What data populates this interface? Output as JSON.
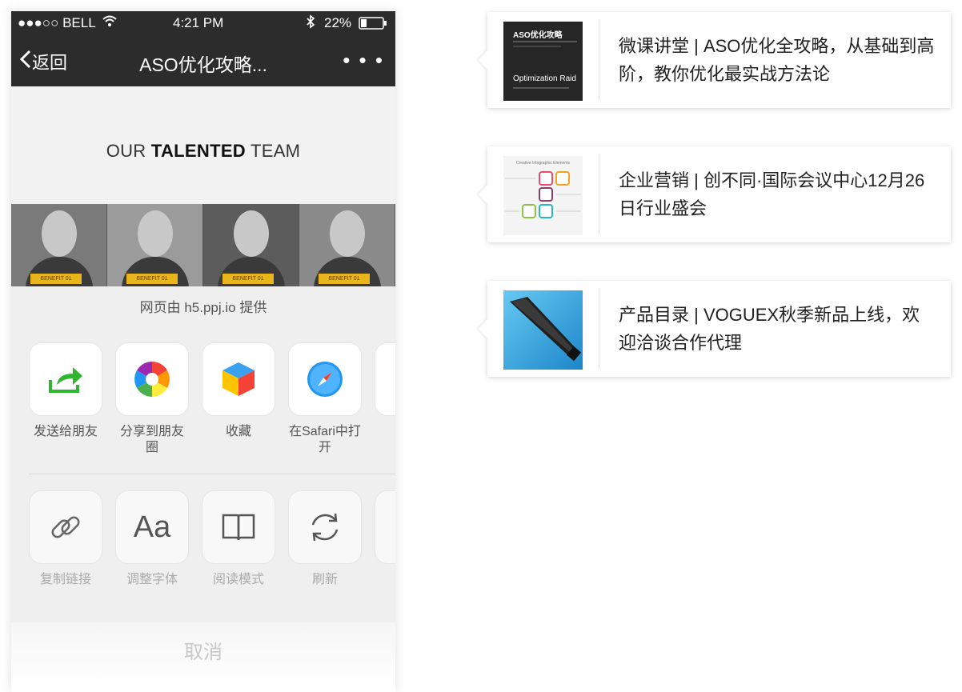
{
  "status_bar": {
    "carrier": "●●●○○ BELL",
    "time": "4:21 PM",
    "battery": "22%"
  },
  "nav": {
    "back_label": "返回",
    "title": "ASO优化攻略...",
    "more": "• • •"
  },
  "webview": {
    "heading_pre": "OUR ",
    "heading_bold": "TALENTED",
    "heading_post": " TEAM",
    "photo_tags": [
      "BENEFIT 01",
      "BENEFIT 01",
      "BENEFIT 01",
      "BENEFIT 01"
    ]
  },
  "share_sheet": {
    "provider": "网页由 h5.ppj.io 提供",
    "share_actions": [
      {
        "label": "发送给朋友",
        "icon": "send-to-friend-icon"
      },
      {
        "label": "分享到朋友圈",
        "icon": "moments-icon"
      },
      {
        "label": "收藏",
        "icon": "favorite-cube-icon"
      },
      {
        "label": "在Safari中打开",
        "icon": "safari-compass-icon"
      }
    ],
    "tool_actions": [
      {
        "label": "复制链接",
        "icon": "link-icon"
      },
      {
        "label": "调整字体",
        "icon": "font-icon",
        "glyph": "Aa"
      },
      {
        "label": "阅读模式",
        "icon": "book-icon"
      },
      {
        "label": "刷新",
        "icon": "refresh-icon"
      }
    ],
    "cancel_label": "取消"
  },
  "cards": [
    {
      "text": "微课讲堂 | ASO优化全攻略，从基础到高阶，教你优化最实战方法论",
      "thumb_title": "ASO优化攻略",
      "thumb_sub": "Optimization Raid"
    },
    {
      "text": "企业营销 | 创不同·国际会议中心12月26日行业盛会",
      "thumb_title": "Creative Infographic Elements"
    },
    {
      "text": "产品目录 | VOGUEX秋季新品上线，欢迎洽谈合作代理"
    }
  ],
  "colors": {
    "nav_bg": "#2c2c2c",
    "accent_green": "#2fb52f",
    "tag_yellow": "#e8b51c"
  }
}
